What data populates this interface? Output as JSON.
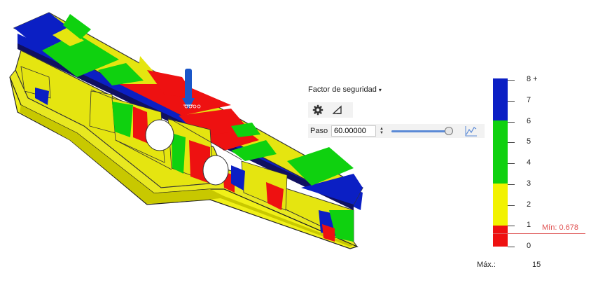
{
  "result_type": {
    "label": "Factor de seguridad",
    "caret": "▾"
  },
  "toolbar": {
    "settings_icon": "gear-icon",
    "probe_icon": "triangle-icon"
  },
  "step": {
    "label": "Paso",
    "value": "60.00000",
    "slider_fraction": 1.0,
    "graph_icon": "graph-icon"
  },
  "legend": {
    "bands": [
      {
        "range": "6-8+",
        "color": "#0b1fc4"
      },
      {
        "range": "3-6",
        "color": "#0fd10f"
      },
      {
        "range": "1-3",
        "color": "#f2f200"
      },
      {
        "range": "0-1",
        "color": "#ee1111"
      }
    ],
    "ticks": [
      "8 +",
      "7",
      "6",
      "5",
      "4",
      "3",
      "2",
      "1",
      "0"
    ],
    "min_text": "Mín: 0.678",
    "max_label": "Máx.:",
    "max_value": "15"
  }
}
